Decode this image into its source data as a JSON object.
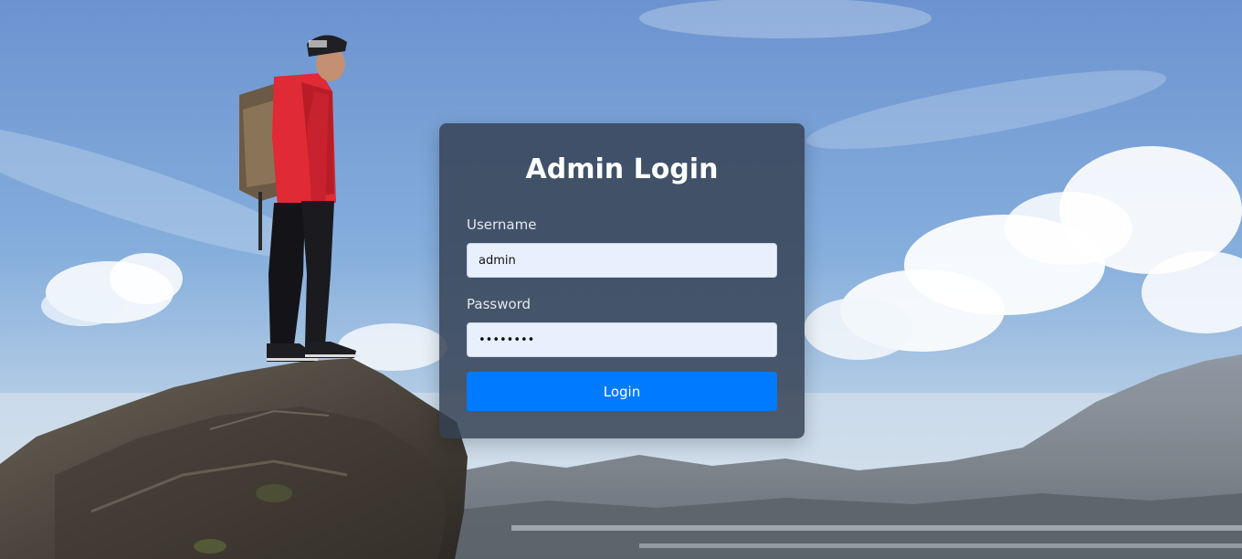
{
  "login": {
    "title": "Admin Login",
    "username_label": "Username",
    "username_value": "admin",
    "password_label": "Password",
    "password_value": "password",
    "button_label": "Login"
  },
  "colors": {
    "card_background": "#344052",
    "input_background": "#e8f0fe",
    "button": "#007bff",
    "title_text": "#ffffff"
  }
}
